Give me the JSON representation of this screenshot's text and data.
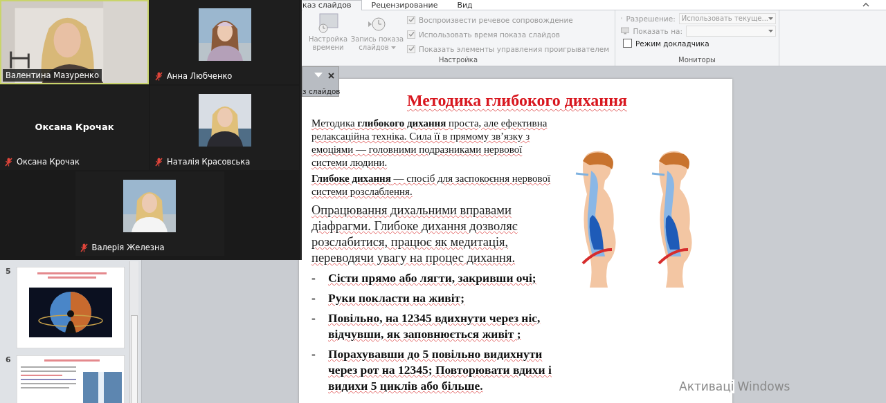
{
  "ribbon": {
    "tabs": [
      {
        "label": "каз слайдов",
        "selected": true
      },
      {
        "label": "Рецензирование",
        "selected": false
      },
      {
        "label": "Вид",
        "selected": false
      }
    ],
    "setup_group": {
      "label": "Настройка",
      "buttons": [
        {
          "label": "Настройка времени",
          "dropdown": false,
          "kind": "timing"
        },
        {
          "label": "Запись показа слайдов",
          "dropdown": true,
          "kind": "record"
        }
      ],
      "options": [
        {
          "label": "Воспроизвести речевое сопровождение",
          "checked": true,
          "disabled": true
        },
        {
          "label": "Использовать время показа слайдов",
          "checked": true,
          "disabled": true
        },
        {
          "label": "Показать элементы управления проигрывателем",
          "checked": true,
          "disabled": true
        }
      ]
    },
    "monitors_group": {
      "label": "Мониторы",
      "fields": [
        {
          "label": "Разрешение:",
          "value": "Использовать текуще...",
          "disabled": true
        },
        {
          "label": "Показать на:",
          "disabled": true
        }
      ],
      "options": [
        {
          "label": "Режим докладчика",
          "checked": false,
          "disabled": false
        }
      ]
    }
  },
  "pane": {
    "title": "з слайдов"
  },
  "thumbnails": [
    {
      "number": "5",
      "kind": "globe"
    },
    {
      "number": "6",
      "kind": "waterfall"
    }
  ],
  "slide": {
    "title": "Методика глибокого дихання",
    "paragraphs": [
      "Методика **глибокого дихання** проста, але ефективна релаксаційна  техніка. Сила її в прямому зв’язку з емоціями — головними подразниками нервової системи людини.",
      "**Глибоке дихання** — спосіб для заспокоєння нервової системи розслаблення."
    ],
    "lead": "Опрацювання дихальними вправами діафрагми. Глибоке дихання дозволяє розслабитися, працює як медитація, переводячи увагу  на процес дихання.",
    "bullets": [
      {
        "marker": "-",
        "text": "Сісти  прямо або лягти, закривши очі;"
      },
      {
        "marker": "-",
        "text": "Руки покласти на живіт;"
      },
      {
        "marker": "-",
        "text": "Повільно,  на 12345 вдихнути через ніс, відчувши, як заповнюється живіт  ;"
      },
      {
        "marker": "-",
        "text": "Порахувавши  до 5 повільно  видихнути через рот  на 12345; Повторювати  вдихи і видихи 5 циклів або більше."
      }
    ]
  },
  "activation": [
    "Активаці",
    "Windows"
  ],
  "video_window": {
    "tiles": [
      {
        "name": "Валентина Мазуренко",
        "kind": "video",
        "muted": false,
        "speaking": true
      },
      {
        "name": "Анна Любченко",
        "muted": true,
        "speaking": false
      },
      {
        "name": "Оксана Крочак",
        "kind": "text",
        "display_name": "Оксана Крочак",
        "muted": true,
        "speaking": false
      },
      {
        "name": "Наталія Красовська",
        "muted": true,
        "speaking": false
      },
      {
        "name": "Валерія Железна",
        "muted": true,
        "speaking": false
      }
    ]
  }
}
